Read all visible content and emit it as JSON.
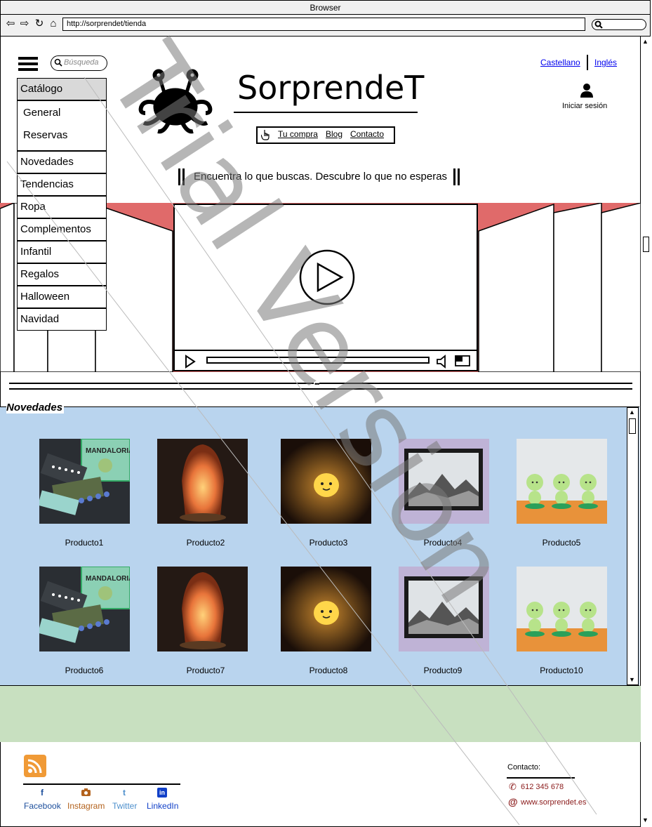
{
  "browser": {
    "title": "Browser",
    "url": "http://sorprendet/tienda"
  },
  "header": {
    "search_placeholder": "Búsqueda",
    "languages": [
      "Castellano",
      "Inglés"
    ],
    "site_title": "SorprendeT",
    "login_label": "Iniciar sesión",
    "nav_links": [
      "Tu compra",
      "Blog",
      "Contacto"
    ],
    "slogan": "Encuentra lo que buscas. Descubre lo que no esperas"
  },
  "menu": {
    "catalog": "Catálogo",
    "submenu": [
      "General",
      "Reservas"
    ],
    "items": [
      "Novedades",
      "Tendencias",
      "Ropa",
      "Complementos",
      "Infantil",
      "Regalos",
      "Halloween",
      "Navidad"
    ]
  },
  "section": {
    "title": "Novedades",
    "divider_label": "•••"
  },
  "products": [
    "Producto1",
    "Producto2",
    "Producto3",
    "Producto4",
    "Producto5",
    "Producto6",
    "Producto7",
    "Producto8",
    "Producto9",
    "Producto10"
  ],
  "footer": {
    "social": [
      "Facebook",
      "Instagram",
      "Twitter",
      "LinkedIn"
    ],
    "contact_title": "Contacto:",
    "phone": "612 345 678",
    "web": "www.sorprendet.es"
  },
  "watermark": "Trial Version",
  "colors": {
    "banner_red": "#e06a6a",
    "novedades_blue": "#b9d4ee",
    "footer_green": "#c8e0c0",
    "facebook": "#1d4f9c",
    "instagram": "#b3621d",
    "twitter": "#4d8fcc",
    "linkedin": "#1140c8",
    "rss": "#f09a36"
  }
}
